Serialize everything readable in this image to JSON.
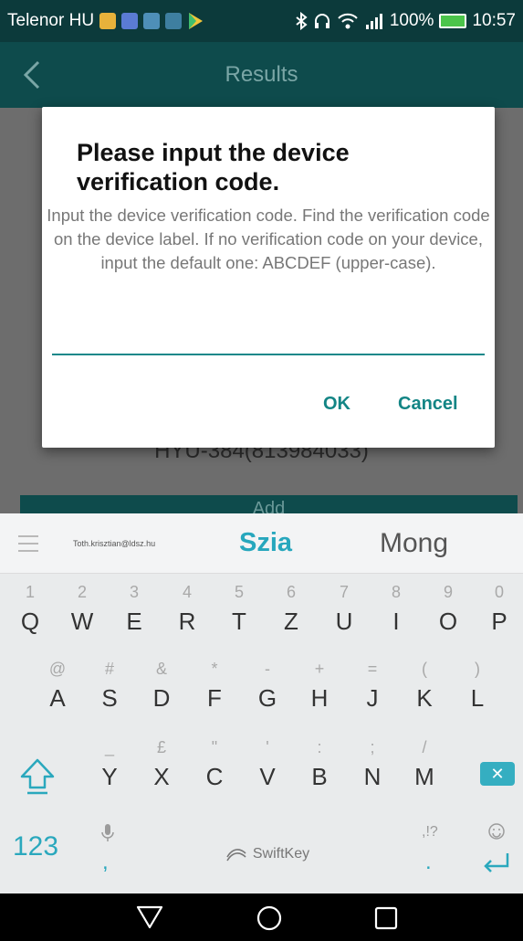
{
  "status_bar": {
    "carrier": "Telenor HU",
    "battery": "100%",
    "time": "10:57",
    "icons": [
      "bluetooth-icon",
      "headphones-icon",
      "wifi-icon",
      "signal-icon"
    ]
  },
  "app_bar": {
    "title": "Results",
    "back_icon": "chevron-left-icon"
  },
  "background": {
    "device_id": "HYU-384(813984033)",
    "add_label": "Add"
  },
  "dialog": {
    "title": "Please input the device verification code.",
    "message": "Input the device verification code. Find the verification code on the device label. If no verification code on your device, input the default one: ABCDEF (upper-case).",
    "input_value": "",
    "ok_label": "OK",
    "cancel_label": "Cancel"
  },
  "keyboard": {
    "suggestions": {
      "email": "Toth.krisztian@ldsz.hu",
      "main": "Szia",
      "alt": "Mong"
    },
    "row1": [
      {
        "key": "Q",
        "hint": "1"
      },
      {
        "key": "W",
        "hint": "2"
      },
      {
        "key": "E",
        "hint": "3"
      },
      {
        "key": "R",
        "hint": "4"
      },
      {
        "key": "T",
        "hint": "5"
      },
      {
        "key": "Z",
        "hint": "6"
      },
      {
        "key": "U",
        "hint": "7"
      },
      {
        "key": "I",
        "hint": "8"
      },
      {
        "key": "O",
        "hint": "9"
      },
      {
        "key": "P",
        "hint": "0"
      }
    ],
    "row2": [
      {
        "key": "A",
        "hint": "@"
      },
      {
        "key": "S",
        "hint": "#"
      },
      {
        "key": "D",
        "hint": "&"
      },
      {
        "key": "F",
        "hint": "*"
      },
      {
        "key": "G",
        "hint": "-"
      },
      {
        "key": "H",
        "hint": "+"
      },
      {
        "key": "J",
        "hint": "="
      },
      {
        "key": "K",
        "hint": "("
      },
      {
        "key": "L",
        "hint": ")"
      }
    ],
    "row3": [
      {
        "key": "Y",
        "hint": "_"
      },
      {
        "key": "X",
        "hint": "£"
      },
      {
        "key": "C",
        "hint": "\""
      },
      {
        "key": "V",
        "hint": "'"
      },
      {
        "key": "B",
        "hint": ":"
      },
      {
        "key": "N",
        "hint": ";"
      },
      {
        "key": "M",
        "hint": "/"
      }
    ],
    "num_label": "123",
    "comma": ",",
    "space_label": "SwiftKey",
    "period_hint": ",!?",
    "period": ".",
    "accent_color": "#2aa8bd"
  },
  "nav_bar": {
    "icons": [
      "back-triangle-icon",
      "home-circle-icon",
      "recents-square-icon"
    ]
  }
}
